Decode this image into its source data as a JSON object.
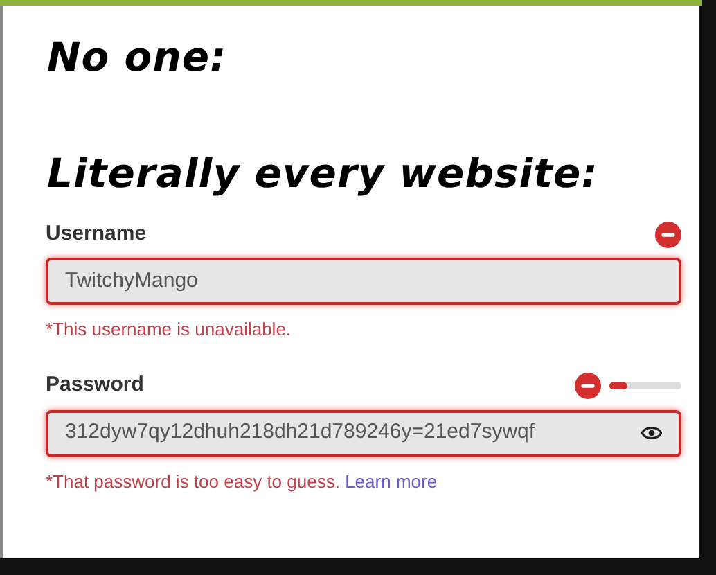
{
  "meme": {
    "lines": [
      "No one:",
      "Literally every website:"
    ]
  },
  "fields": [
    {
      "kind": "text",
      "label": "Username",
      "value": "TwitchyMango",
      "invalid": true,
      "error": "*This username is unavailable."
    },
    {
      "kind": "password",
      "label": "Password",
      "value": "312dyw7qy12dhuh218dh21d789246y=21ed7sywqf",
      "invalid": true,
      "strength": {
        "level": 0.25
      },
      "error": "*That password is too easy to guess.",
      "error_link": "Learn more"
    }
  ]
}
